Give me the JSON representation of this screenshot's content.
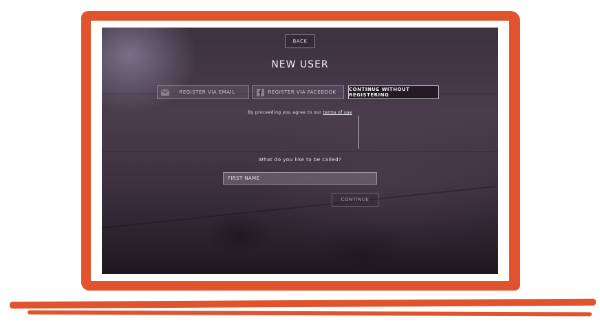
{
  "screen": {
    "back_label": "BACK",
    "title": "NEW USER",
    "register_email_label": "REGISTER VIA EMAIL",
    "register_facebook_label": "REGISTER VIA FACEBOOK",
    "continue_without_label": "CONTINUE WITHOUT REGISTERING",
    "terms_prefix": "By proceeding you agree to our",
    "terms_link": "terms of use",
    "question": "What do you like to be called?",
    "first_name_placeholder": "FIRST NAME",
    "continue_label": "CONTINUE"
  },
  "icons": {
    "email": "mail-icon",
    "facebook": "facebook-icon"
  },
  "colors": {
    "frame": "#e0532c",
    "screen_bg": "#3b3140"
  }
}
